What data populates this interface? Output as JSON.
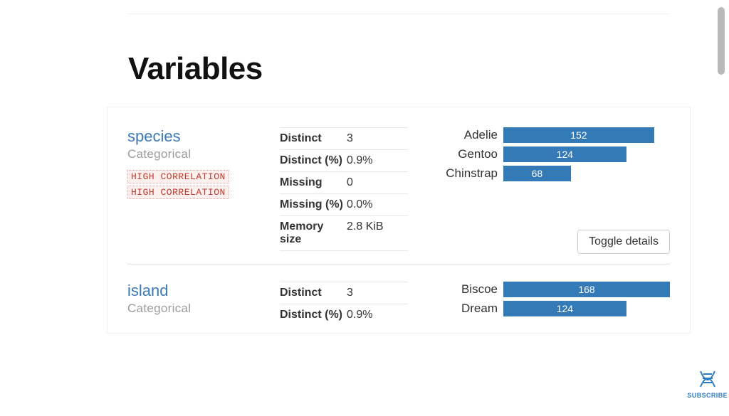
{
  "section_title": "Variables",
  "toggle_label": "Toggle details",
  "subscribe_label": "SUBSCRIBE",
  "stat_labels": {
    "distinct": "Distinct",
    "distinct_pct": "Distinct (%)",
    "missing": "Missing",
    "missing_pct": "Missing (%)",
    "memory": "Memory size"
  },
  "variables": [
    {
      "name": "species",
      "type": "Categorical",
      "warnings": [
        "HIGH CORRELATION",
        "HIGH CORRELATION"
      ],
      "stats": {
        "distinct": "3",
        "distinct_pct": "0.9%",
        "missing": "0",
        "missing_pct": "0.0%",
        "memory": "2.8 KiB"
      },
      "chart_data": {
        "type": "bar",
        "max": 168,
        "bars": [
          {
            "label": "Adelie",
            "value": 152
          },
          {
            "label": "Gentoo",
            "value": 124
          },
          {
            "label": "Chinstrap",
            "value": 68
          }
        ]
      }
    },
    {
      "name": "island",
      "type": "Categorical",
      "warnings": [],
      "stats": {
        "distinct": "3",
        "distinct_pct": "0.9%"
      },
      "chart_data": {
        "type": "bar",
        "max": 168,
        "bars": [
          {
            "label": "Biscoe",
            "value": 168
          },
          {
            "label": "Dream",
            "value": 124
          }
        ]
      }
    }
  ]
}
